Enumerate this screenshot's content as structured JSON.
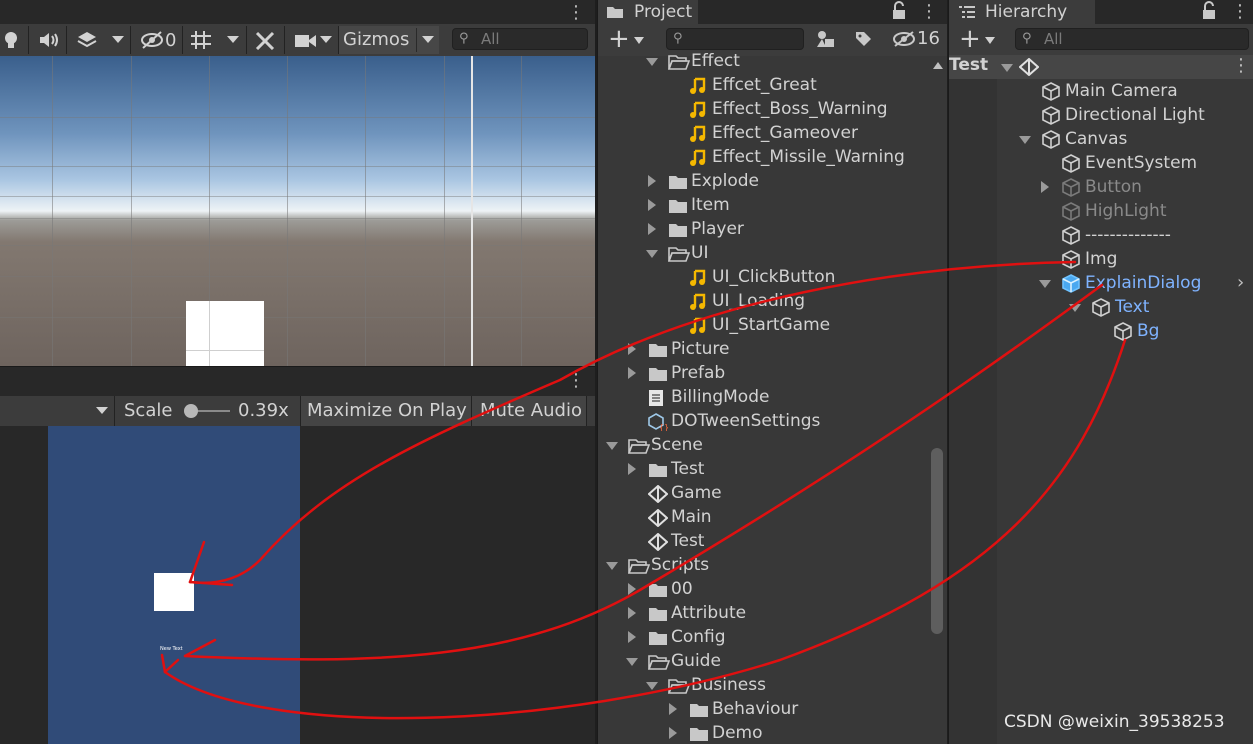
{
  "scene_toolbar": {
    "hidden_count": "0",
    "gizmos_label": "Gizmos",
    "search_placeholder": "All"
  },
  "game_toolbar": {
    "scale_label": "Scale",
    "scale_value": "0.39x",
    "maximize_label": "Maximize On Play",
    "mute_label": "Mute Audio"
  },
  "game_view": {
    "text_label": "New Text"
  },
  "project": {
    "tab_label": "Project",
    "hidden_count": "16",
    "items": [
      {
        "label": "Effect",
        "type": "folder-open",
        "depth": 0
      },
      {
        "label": "Effcet_Great",
        "type": "audio",
        "depth": 1
      },
      {
        "label": "Effect_Boss_Warning",
        "type": "audio",
        "depth": 1
      },
      {
        "label": "Effect_Gameover",
        "type": "audio",
        "depth": 1
      },
      {
        "label": "Effect_Missile_Warning",
        "type": "audio",
        "depth": 1
      },
      {
        "label": "Explode",
        "type": "folder",
        "depth": 0
      },
      {
        "label": "Item",
        "type": "folder",
        "depth": 0
      },
      {
        "label": "Player",
        "type": "folder",
        "depth": 0
      },
      {
        "label": "UI",
        "type": "folder-open",
        "depth": 0
      },
      {
        "label": "UI_ClickButton",
        "type": "audio",
        "depth": 1
      },
      {
        "label": "UI_Loading",
        "type": "audio",
        "depth": 1
      },
      {
        "label": "UI_StartGame",
        "type": "audio",
        "depth": 1
      },
      {
        "label": "Picture",
        "type": "folder",
        "depth": -1
      },
      {
        "label": "Prefab",
        "type": "folder",
        "depth": -1
      },
      {
        "label": "BillingMode",
        "type": "doc",
        "depth": -1
      },
      {
        "label": "DOTweenSettings",
        "type": "asset",
        "depth": -1
      },
      {
        "label": "Scene",
        "type": "folder-open",
        "depth": -2
      },
      {
        "label": "Test",
        "type": "folder",
        "depth": -1
      },
      {
        "label": "Game",
        "type": "unity",
        "depth": -1
      },
      {
        "label": "Main",
        "type": "unity",
        "depth": -1
      },
      {
        "label": "Test",
        "type": "unity",
        "depth": -1
      },
      {
        "label": "Scripts",
        "type": "folder-open",
        "depth": -2
      },
      {
        "label": "00",
        "type": "folder",
        "depth": -1
      },
      {
        "label": "Attribute",
        "type": "folder",
        "depth": -1
      },
      {
        "label": "Config",
        "type": "folder",
        "depth": -1
      },
      {
        "label": "Guide",
        "type": "folder-open",
        "depth": -1
      },
      {
        "label": "Business",
        "type": "folder-open",
        "depth": 0
      },
      {
        "label": "Behaviour",
        "type": "folder",
        "depth": 1
      },
      {
        "label": "Demo",
        "type": "folder",
        "depth": 1
      }
    ]
  },
  "hierarchy": {
    "tab_label": "Hierarchy",
    "search_placeholder": "All",
    "scene_name": "Test",
    "items": [
      {
        "label": "Main Camera",
        "state": "normal"
      },
      {
        "label": "Directional Light",
        "state": "normal"
      },
      {
        "label": "Canvas",
        "state": "normal"
      },
      {
        "label": "EventSystem",
        "state": "normal"
      },
      {
        "label": "Button",
        "state": "inactive"
      },
      {
        "label": "HighLight",
        "state": "inactive"
      },
      {
        "label": "--------------",
        "state": "normal"
      },
      {
        "label": "Img",
        "state": "normal"
      },
      {
        "label": "ExplainDialog",
        "state": "prefab"
      },
      {
        "label": "Text",
        "state": "prefab"
      },
      {
        "label": "Bg",
        "state": "prefab"
      }
    ]
  },
  "watermark": "CSDN @weixin_39538253",
  "colors": {
    "accent_blue": "#7fb3ff",
    "annotation_red": "#e01010",
    "game_canvas": "#304b78",
    "audio_icon": "#f5b800"
  }
}
